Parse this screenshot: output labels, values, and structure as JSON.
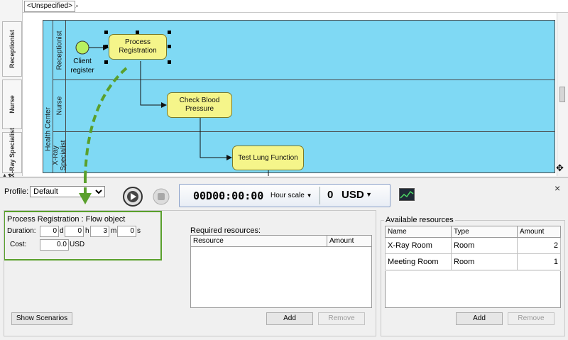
{
  "diagram": {
    "unspecified_tab": "<Unspecified>",
    "side_tabs": [
      "Receptionist",
      "Nurse",
      "X-Ray Specialist"
    ],
    "pool_name": "Health Center",
    "lanes": [
      "Receptionist",
      "Nurse",
      "X-Ray Specialist"
    ],
    "start_event_label": "Client register",
    "tasks": [
      "Process Registration",
      "Check Blood Pressure",
      "Test Lung Function"
    ]
  },
  "toolbar": {
    "profile_label": "Profile:",
    "profile_value": "Default",
    "clock_time": "00D00:00:00",
    "hour_scale_label": "Hour scale",
    "cost_value": "0",
    "cost_currency": "USD",
    "close_symbol": "×"
  },
  "flow_object": {
    "title": "Process Registration : Flow object",
    "duration_label": "Duration:",
    "days": "0",
    "days_unit": "d",
    "hours": "0",
    "hours_unit": "h",
    "minutes": "3",
    "minutes_unit": "m",
    "seconds": "0",
    "seconds_unit": "s",
    "cost_label": "Cost:",
    "cost_value": "0.0",
    "cost_unit": "USD"
  },
  "required_resources": {
    "title": "Required resources:",
    "columns": [
      "Resource",
      "Amount"
    ],
    "add_label": "Add",
    "remove_label": "Remove"
  },
  "available_resources": {
    "title": "Available resources",
    "columns": [
      "Name",
      "Type",
      "Amount"
    ],
    "rows": [
      {
        "name": "X-Ray Room",
        "type": "Room",
        "amount": "2"
      },
      {
        "name": "Meeting Room",
        "type": "Room",
        "amount": "1"
      }
    ],
    "add_label": "Add",
    "remove_label": "Remove"
  },
  "show_scenarios_label": "Show Scenarios",
  "colors": {
    "pool": "#7fd9f4",
    "task": "#f5f58a",
    "start_event": "#b8f060",
    "highlight": "#5aa02c"
  }
}
